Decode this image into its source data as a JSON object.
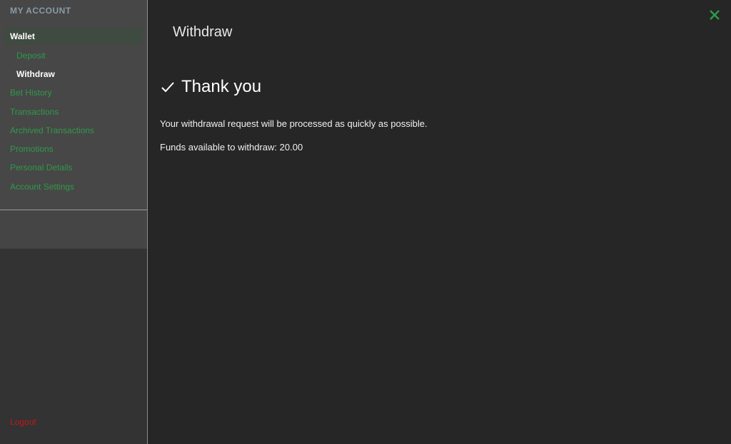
{
  "sidebar": {
    "title": "MY ACCOUNT",
    "items": [
      {
        "label": "Wallet",
        "active": true
      },
      {
        "label": "Deposit",
        "sub": true
      },
      {
        "label": "Withdraw",
        "sub": true,
        "active": true
      },
      {
        "label": "Bet History"
      },
      {
        "label": "Transactions"
      },
      {
        "label": "Archived Transactions"
      },
      {
        "label": "Promotions"
      },
      {
        "label": "Personal Details"
      },
      {
        "label": "Account Settings"
      }
    ],
    "logout_label": "Logout"
  },
  "main": {
    "title": "Withdraw",
    "close_icon": "close-icon",
    "heading": "Thank you",
    "heading_icon": "checkmark-icon",
    "message": "Your withdrawal request will be processed as quickly as possible.",
    "funds_label": "Funds available to withdraw: 20.00"
  },
  "colors": {
    "accent_green": "#2f9a48",
    "logout_red": "#c0171b",
    "background": "#262626",
    "sidebar": "#474747"
  }
}
